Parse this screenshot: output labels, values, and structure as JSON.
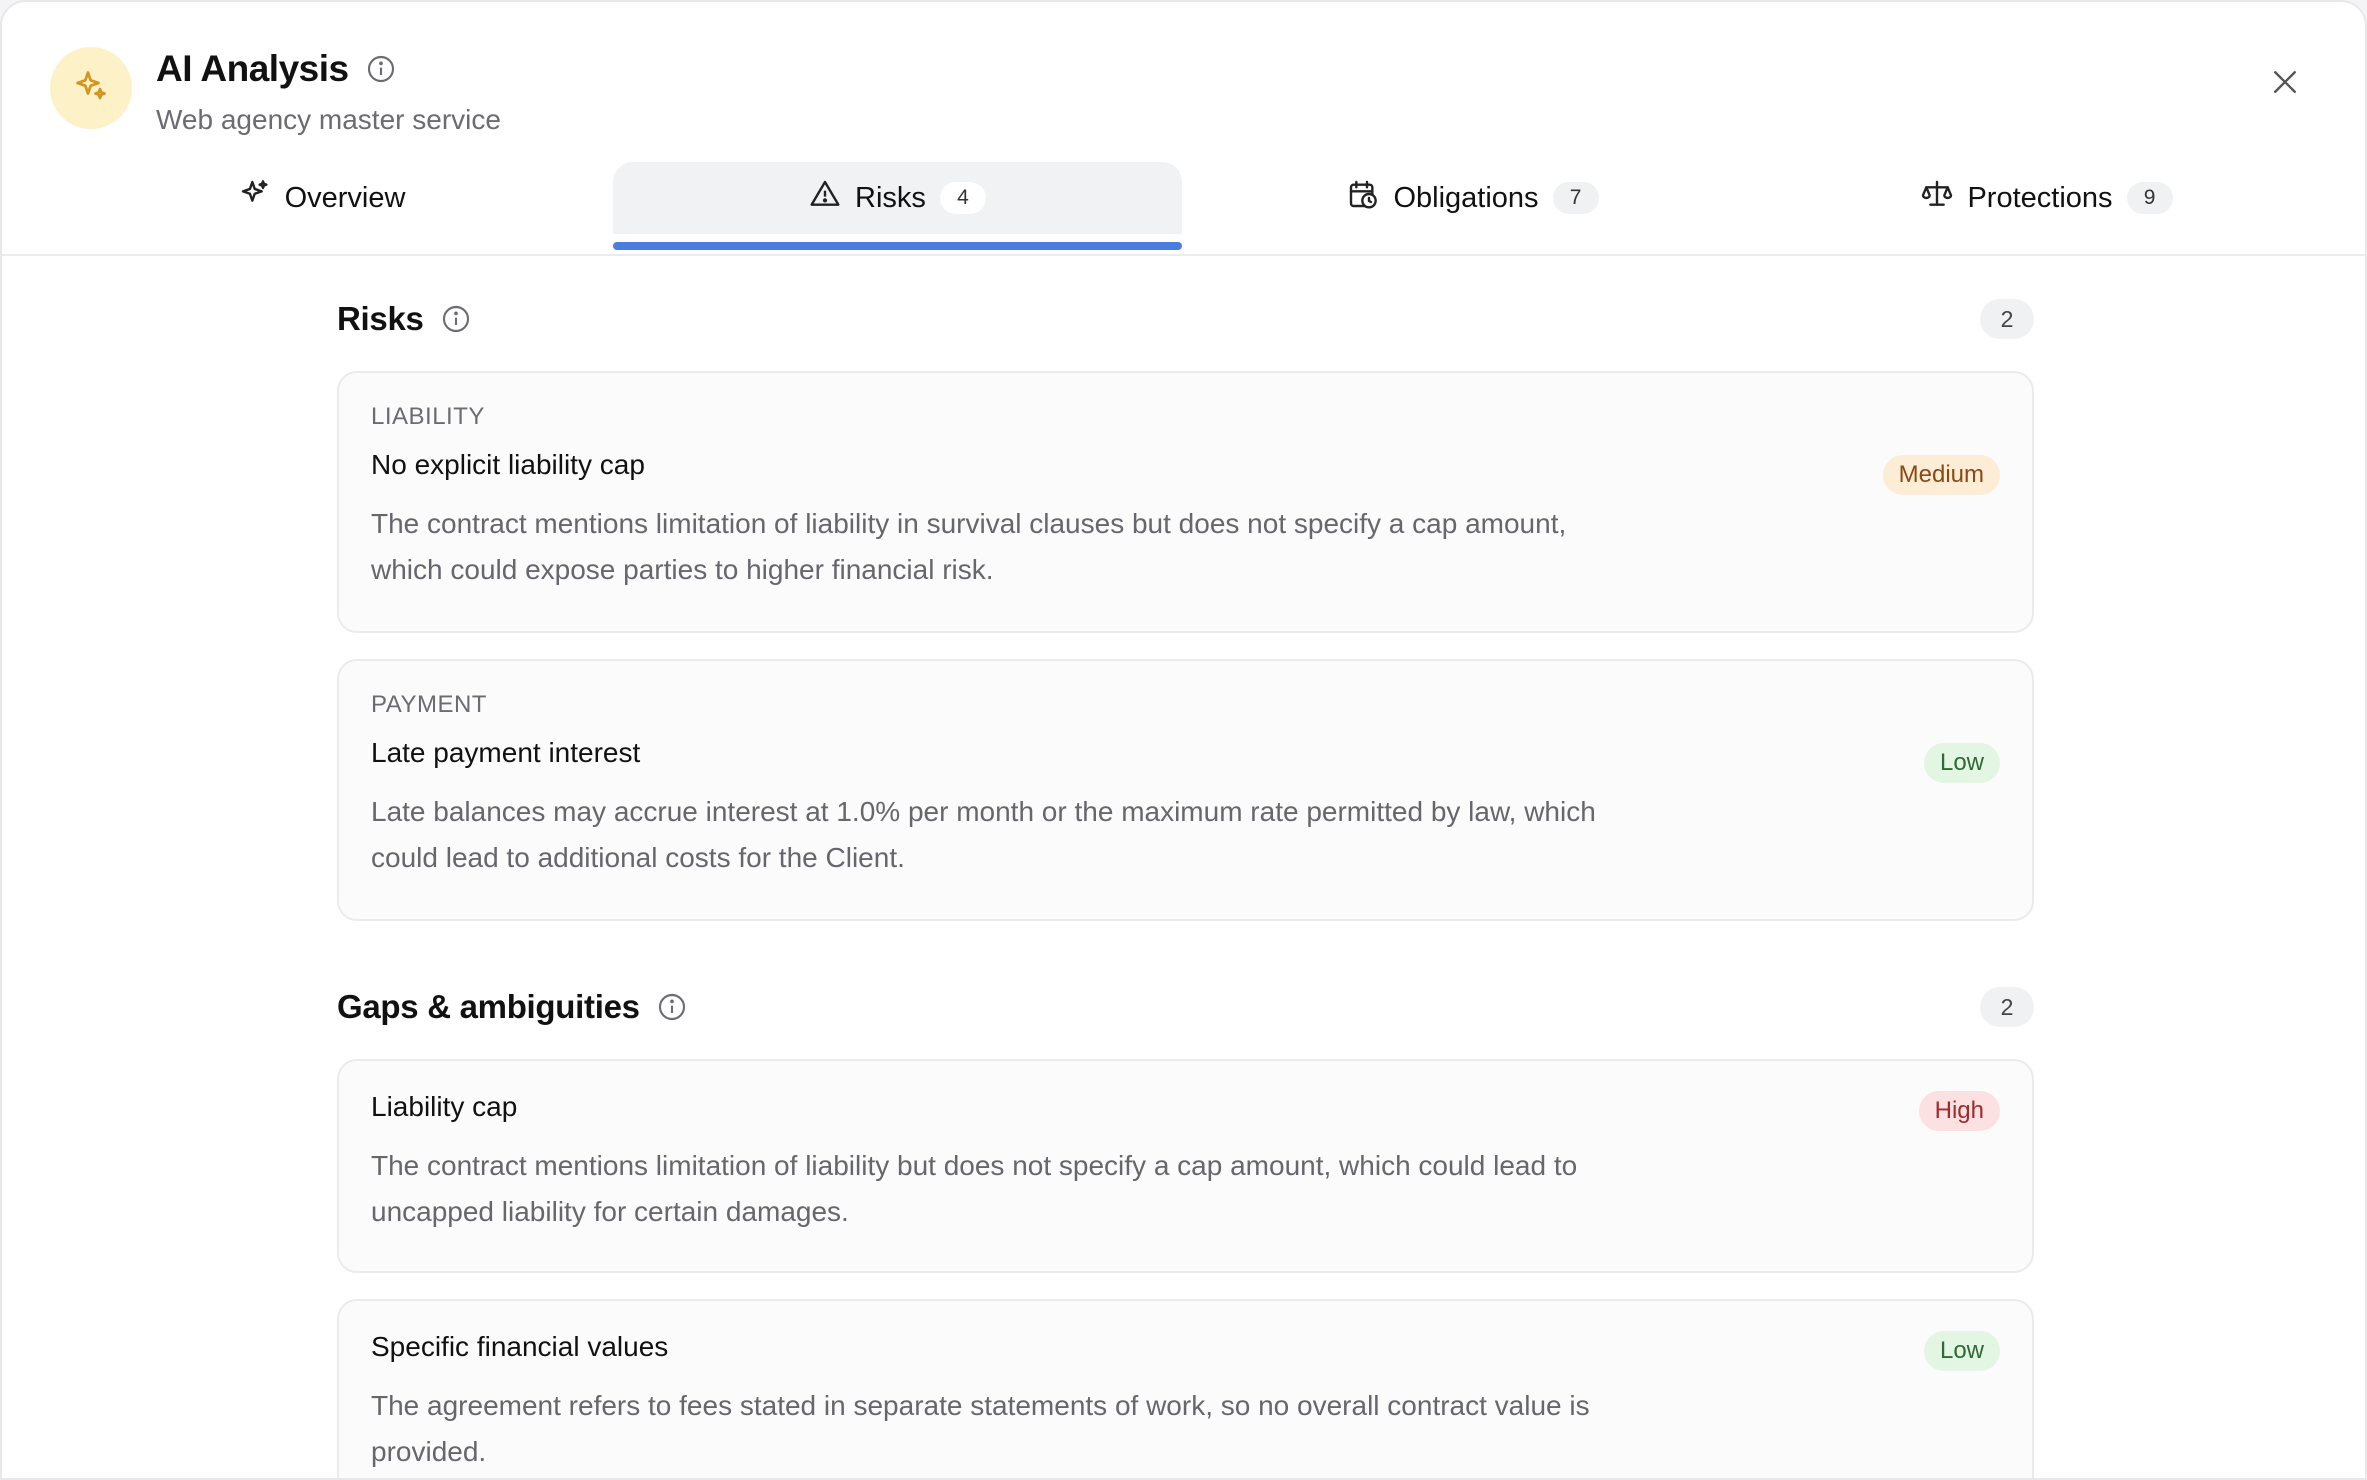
{
  "header": {
    "title": "AI Analysis",
    "subtitle": "Web agency master service",
    "accent": "#e0a32b"
  },
  "tabs": [
    {
      "label": "Overview",
      "count": "",
      "icon": "sparkle-icon",
      "active": false
    },
    {
      "label": "Risks",
      "count": "4",
      "icon": "warning-triangle-icon",
      "active": true
    },
    {
      "label": "Obligations",
      "count": "7",
      "icon": "calendar-clock-icon",
      "active": false
    },
    {
      "label": "Protections",
      "count": "9",
      "icon": "scales-icon",
      "active": false
    }
  ],
  "colors": {
    "tab_underline": "#4a7de0",
    "badge_medium": "#fdecd6",
    "badge_low": "#e3f5e3",
    "badge_high": "#fbe1e1"
  },
  "sections": {
    "risks": {
      "title": "Risks",
      "count": "2",
      "items": [
        {
          "category": "LIABILITY",
          "title": "No explicit liability cap",
          "severity": "Medium",
          "description": "The contract mentions limitation of liability in survival clauses but does not specify a cap amount, which could expose parties to higher financial risk."
        },
        {
          "category": "PAYMENT",
          "title": "Late payment interest",
          "severity": "Low",
          "description": "Late balances may accrue interest at 1.0% per month or the maximum rate permitted by law, which could lead to additional costs for the Client."
        }
      ]
    },
    "gaps": {
      "title": "Gaps & ambiguities",
      "count": "2",
      "items": [
        {
          "title": "Liability cap",
          "severity": "High",
          "description": "The contract mentions limitation of liability but does not specify a cap amount, which could lead to uncapped liability for certain damages."
        },
        {
          "title": "Specific financial values",
          "severity": "Low",
          "description": "The agreement refers to fees stated in separate statements of work, so no overall contract value is provided."
        }
      ]
    }
  }
}
